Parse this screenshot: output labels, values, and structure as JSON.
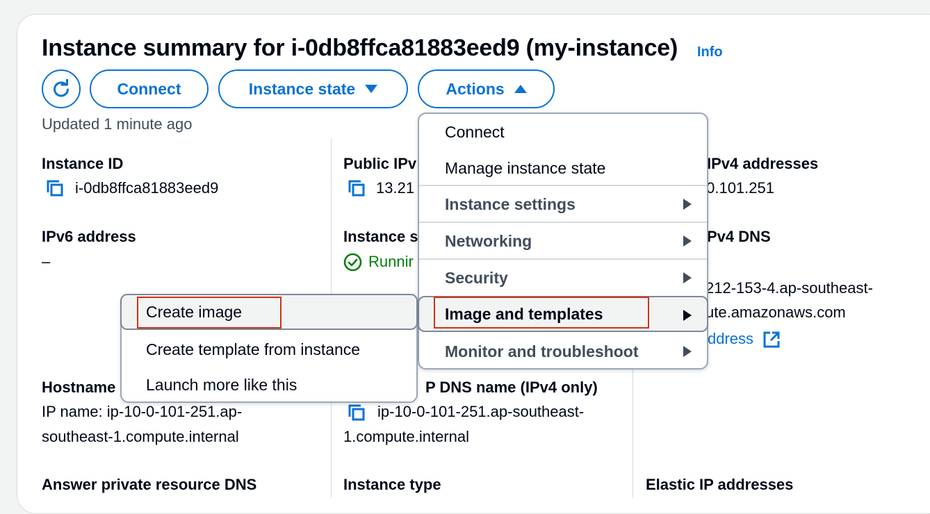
{
  "header": {
    "title": "Instance summary for i-0db8ffca81883eed9 (my-instance)",
    "info": "Info",
    "updated": "Updated 1 minute ago"
  },
  "toolbar": {
    "refresh_icon": "refresh-icon",
    "connect": "Connect",
    "instance_state": "Instance state",
    "actions": "Actions"
  },
  "details": {
    "instance_id_label": "Instance ID",
    "instance_id_value": "i-0db8ffca81883eed9",
    "public_ip_label": "Public IPv",
    "public_ip_value": "13.21",
    "private_ip_label": "IPv4 addresses",
    "private_ip_value": ".0.101.251",
    "ipv6_label": "IPv6 address",
    "ipv6_value": "–",
    "instance_state_label": "Instance s",
    "instance_state_value": "Runnir",
    "public_dns_label": "Pv4 DNS",
    "public_dns_value_1": "212-153-4.ap-southeast-",
    "public_dns_value_2": "ute.amazonaws.com",
    "public_dns_link": "ddress",
    "hostname_label": "Hostname",
    "hostname_value_1": "IP name: ip-10-0-101-251.ap-",
    "hostname_value_2": "southeast-1.compute.internal",
    "private_dns_label": "P DNS name (IPv4 only)",
    "private_dns_value_1": "ip-10-0-101-251.ap-southeast-",
    "private_dns_value_2": "1.compute.internal",
    "answer_dns_label": "Answer private resource DNS",
    "instance_type_label": "Instance type",
    "elastic_ip_label": "Elastic IP addresses"
  },
  "actions_menu": {
    "items": [
      {
        "label": "Connect"
      },
      {
        "label": "Manage instance state"
      },
      {
        "label": "Instance settings"
      },
      {
        "label": "Networking"
      },
      {
        "label": "Security"
      },
      {
        "label": "Image and templates"
      },
      {
        "label": "Monitor and troubleshoot"
      }
    ]
  },
  "image_submenu": {
    "items": [
      {
        "label": "Create image"
      },
      {
        "label": "Create template from instance"
      },
      {
        "label": "Launch more like this"
      }
    ]
  },
  "colors": {
    "accent": "#0972d3",
    "success": "#037f0c",
    "highlight": "#d13212"
  }
}
